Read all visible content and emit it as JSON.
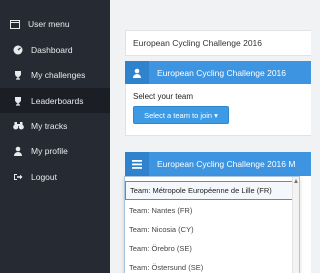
{
  "sidebar": {
    "menu_header": "User menu",
    "items": [
      {
        "label": "Dashboard",
        "icon": "dashboard-icon"
      },
      {
        "label": "My challenges",
        "icon": "trophy-icon"
      },
      {
        "label": "Leaderboards",
        "icon": "trophy-icon",
        "active": true
      },
      {
        "label": "My tracks",
        "icon": "binoculars-icon"
      },
      {
        "label": "My profile",
        "icon": "user-icon"
      },
      {
        "label": "Logout",
        "icon": "logout-icon"
      }
    ]
  },
  "main": {
    "title": "European Cycling Challenge 2016",
    "panel1": {
      "header": "European Cycling Challenge 2016",
      "select_label": "Select your team",
      "button_label": "Select a team to join ▾"
    },
    "panel2": {
      "header": "European Cycling Challenge 2016 M"
    },
    "dropdown": {
      "options": [
        "Team: Métropole Européenne de Lille (FR)",
        "Team: Nantes (FR)",
        "Team: Nicosia (CY)",
        "Team: Örebro (SE)",
        "Team: Östersund (SE)"
      ]
    }
  },
  "colors": {
    "sidebar_bg": "#262b33",
    "accent": "#3d94e0",
    "page_bg": "#f1f2f3"
  }
}
